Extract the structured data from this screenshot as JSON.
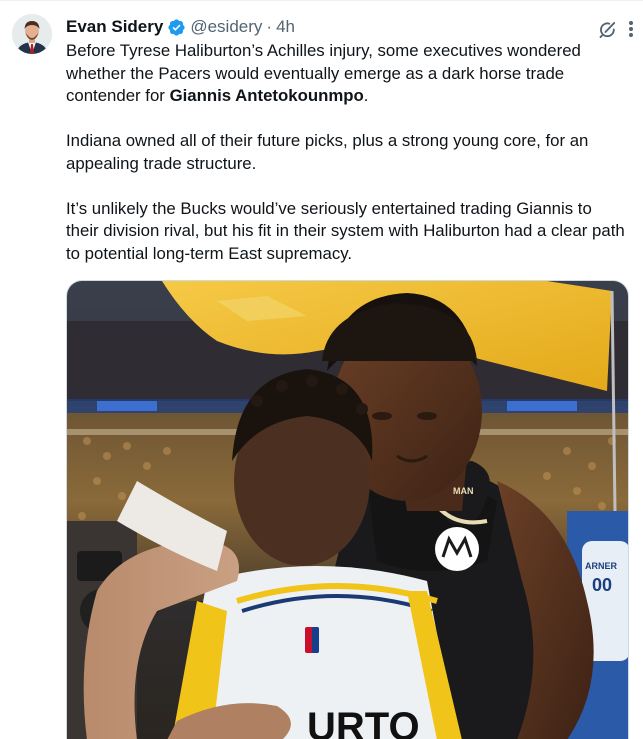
{
  "author": {
    "display_name": "Evan Sidery",
    "handle": "@esidery",
    "separator": "·",
    "timestamp": "4h",
    "verified": true,
    "avatar_icon": "avatar-photo"
  },
  "actions": {
    "grok_icon": "grok-icon",
    "more_icon": "more-icon"
  },
  "tweet": {
    "p1_a": "Before Tyrese Haliburton’s Achilles injury, some executives wondered whether the Pacers would eventually emerge as a dark horse trade contender for ",
    "p1_bold": "Giannis Antetokounmpo",
    "p1_end": ".",
    "p2": "Indiana owned all of their future picks, plus a strong young core, for an appealing trade structure.",
    "p3": "It’s unlikely the Bucks would’ve seriously entertained trading Giannis to their division rival, but his fit in their system with Haliburton had a clear path to potential long-term East supremacy."
  },
  "media": {
    "jersey_back_text": "URTO",
    "jersey_right_text": "00",
    "jersey_right_small": "ARNER",
    "bucks_badge_text": "MAN"
  },
  "colors": {
    "text": "#0f1419",
    "muted": "#536471",
    "verified_blue": "#1d9bf0",
    "flag_yellow": "#f2c53d"
  }
}
